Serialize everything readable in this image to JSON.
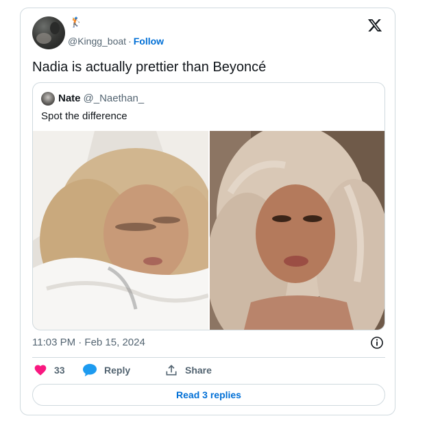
{
  "author": {
    "handle": "@Kingg_boat",
    "separator": "·",
    "follow_label": "Follow",
    "emoji": "🏌️"
  },
  "tweet": {
    "text": "Nadia is actually prettier than Beyoncé",
    "timestamp": "11:03 PM · Feb 15, 2024"
  },
  "quoted": {
    "name": "Nate",
    "handle": "@_Naethan_",
    "text": "Spot the difference"
  },
  "actions": {
    "like_count": "33",
    "reply_label": "Reply",
    "share_label": "Share",
    "read_replies_label": "Read 3 replies"
  },
  "colors": {
    "accent": "#006fd6",
    "like": "#f91880",
    "muted": "#536471",
    "border": "#cfd9de"
  },
  "icons": [
    "x-logo-icon",
    "info-icon",
    "heart-icon",
    "reply-bubble-icon",
    "share-icon",
    "golfer-emoji"
  ]
}
